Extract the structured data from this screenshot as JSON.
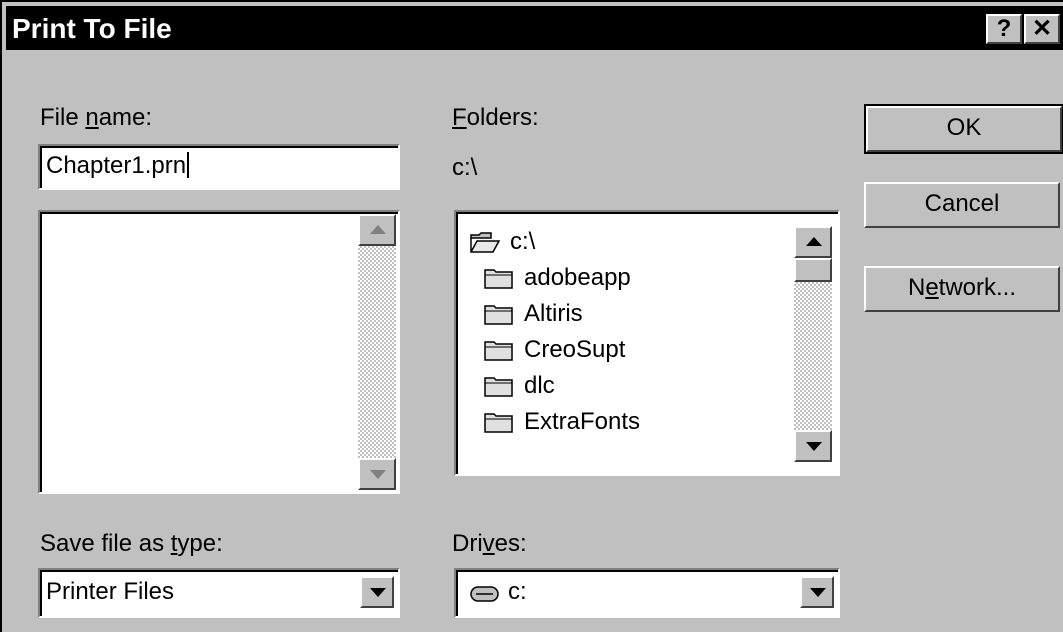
{
  "window": {
    "title": "Print To File",
    "help_button": "?",
    "close_button": "✕"
  },
  "file_name": {
    "label_pre": "File ",
    "label_mnemonic": "n",
    "label_post": "ame:",
    "value": "Chapter1.prn",
    "files": []
  },
  "folders": {
    "label_mnemonic": "F",
    "label_post": "olders:",
    "current_path": "c:\\",
    "items": [
      {
        "name": "c:\\",
        "icon": "open-folder-icon"
      },
      {
        "name": "adobeapp",
        "icon": "folder-icon"
      },
      {
        "name": "Altiris",
        "icon": "folder-icon"
      },
      {
        "name": "CreoSupt",
        "icon": "folder-icon"
      },
      {
        "name": "dlc",
        "icon": "folder-icon"
      },
      {
        "name": "ExtraFonts",
        "icon": "folder-icon"
      }
    ]
  },
  "buttons": {
    "ok": "OK",
    "cancel": "Cancel",
    "network_pre": "N",
    "network_mnemonic": "e",
    "network_post": "twork..."
  },
  "save_type": {
    "label_pre": "Save file as ",
    "label_mnemonic": "t",
    "label_post": "ype:",
    "value": "Printer Files"
  },
  "drives": {
    "label_pre": "Dri",
    "label_mnemonic": "v",
    "label_post": "es:",
    "value": "c:",
    "icon": "drive-icon"
  }
}
